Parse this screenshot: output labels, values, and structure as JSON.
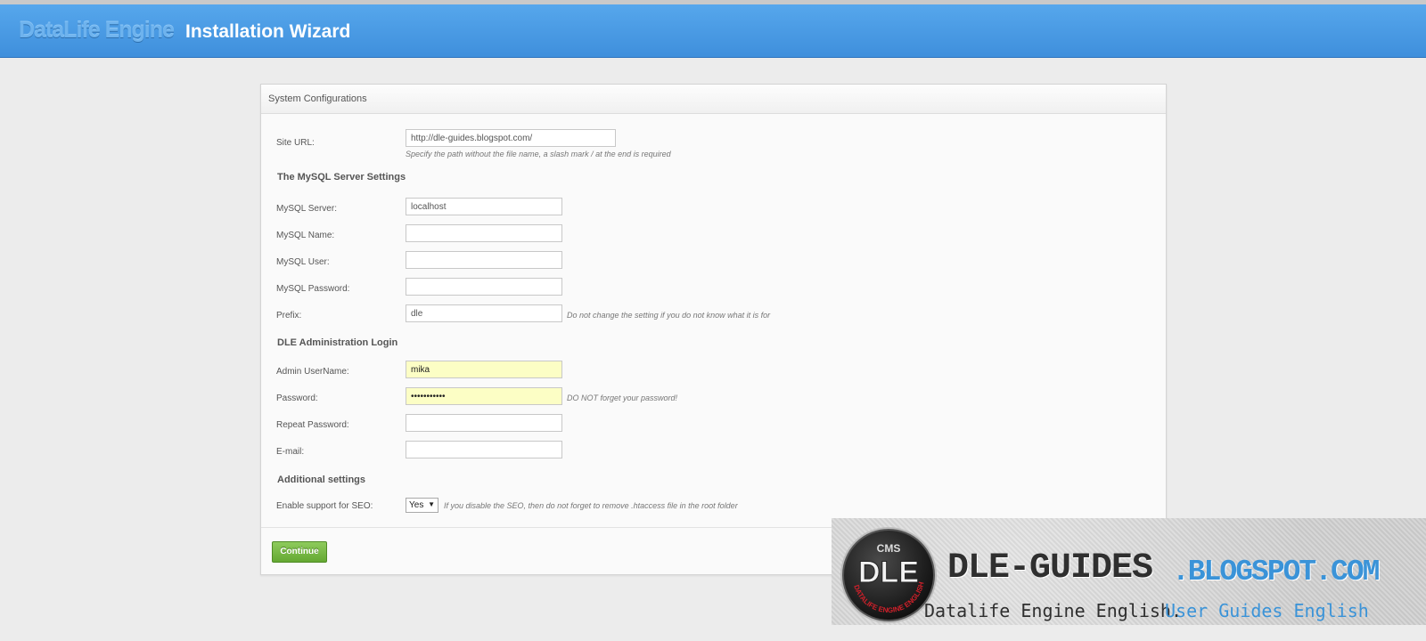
{
  "header": {
    "logo_text": "DataLife Engine",
    "title": "Installation Wizard"
  },
  "panel": {
    "title": "System Configurations",
    "site_url": {
      "label": "Site URL:",
      "value": "http://dle-guides.blogspot.com/",
      "hint": "Specify the path without the file name, a slash mark / at the end is required"
    },
    "mysql_section": "The MySQL Server Settings",
    "mysql_server": {
      "label": "MySQL Server:",
      "value": "localhost"
    },
    "mysql_name": {
      "label": "MySQL Name:",
      "value": ""
    },
    "mysql_user": {
      "label": "MySQL User:",
      "value": ""
    },
    "mysql_password": {
      "label": "MySQL Password:",
      "value": ""
    },
    "prefix": {
      "label": "Prefix:",
      "value": "dle",
      "hint": "Do not change the setting if you do not know what it is for"
    },
    "admin_section": "DLE Administration Login",
    "admin_username": {
      "label": "Admin UserName:",
      "value": "mika"
    },
    "password": {
      "label": "Password:",
      "value": "•••••••••••",
      "hint": "DO NOT forget your password!"
    },
    "repeat_password": {
      "label": "Repeat Password:",
      "value": ""
    },
    "email": {
      "label": "E-mail:",
      "value": ""
    },
    "additional_section": "Additional settings",
    "seo": {
      "label": "Enable support for SEO:",
      "selected": "Yes",
      "hint": "If you disable the SEO, then do not forget to remove .htaccess file in the root folder"
    },
    "continue_label": "Continue"
  },
  "banner": {
    "badge_top": "CMS",
    "badge_main": "DLE",
    "badge_ring": "DATALIFE ENGINE ENGLISH",
    "title_main": "DLE-GUIDES",
    "title_domain": ".BLOGSPOT.COM",
    "subtitle_dark": "Datalife Engine English.",
    "subtitle_blue": "User Guides English"
  },
  "colors": {
    "header_blue": "#4a9be5",
    "continue_green": "#6fb03f",
    "autofill_yellow": "#fcfec5",
    "brand_blue": "#3a93d8",
    "badge_red": "#d0202a"
  }
}
